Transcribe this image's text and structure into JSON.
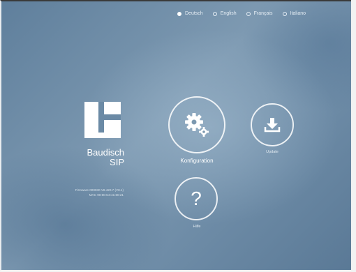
{
  "languages": [
    {
      "label": "Deutsch",
      "selected": true
    },
    {
      "label": "English",
      "selected": false
    },
    {
      "label": "Français",
      "selected": false
    },
    {
      "label": "Italiano",
      "selected": false
    }
  ],
  "brand": {
    "line1": "Baudisch",
    "line2": "SIP",
    "logo_icon": "baudisch-logo"
  },
  "firmware": {
    "line1": "Firmware 000030 V8.420.7 (V8.1)",
    "line2": "MAC 90:60:C3:41:60:21"
  },
  "buttons": {
    "config": {
      "label": "Konfiguration",
      "icon": "gear-icon"
    },
    "update": {
      "label": "Update",
      "icon": "download-icon"
    },
    "help": {
      "label": "Hilfe",
      "icon": "question-icon",
      "glyph": "?"
    }
  }
}
